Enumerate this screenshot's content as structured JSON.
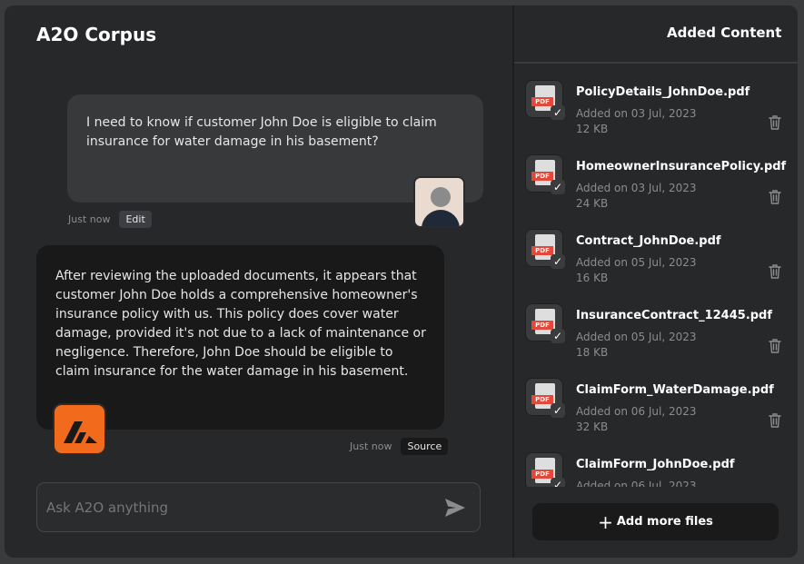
{
  "app": {
    "title": "A2O Corpus"
  },
  "messages": {
    "user": {
      "text": "I need to know if customer John Doe is eligible to claim insurance for water damage in his basement?",
      "time": "Just now",
      "action": "Edit"
    },
    "assistant": {
      "text": "After reviewing the uploaded documents, it appears that customer John Doe holds a comprehensive homeowner's insurance policy with us. This policy does cover water damage, provided it's not due to a lack of maintenance or negligence. Therefore, John Doe should be eligible to claim insurance for the water damage in his basement.",
      "time": "Just now",
      "action": "Source"
    }
  },
  "input": {
    "placeholder": "Ask A2O anything",
    "value": ""
  },
  "panel": {
    "title": "Added Content",
    "files": [
      {
        "name": "PolicyDetails_JohnDoe.pdf",
        "date": "Added on 03 Jul, 2023",
        "size": "12 KB"
      },
      {
        "name": "HomeownerInsurancePolicy.pdf",
        "date": "Added on 03 Jul, 2023",
        "size": "24 KB"
      },
      {
        "name": "Contract_JohnDoe.pdf",
        "date": "Added on 05 Jul, 2023",
        "size": "16 KB"
      },
      {
        "name": "InsuranceContract_12445.pdf",
        "date": "Added on 05 Jul, 2023",
        "size": "18 KB"
      },
      {
        "name": "ClaimForm_WaterDamage.pdf",
        "date": "Added on 06 Jul, 2023",
        "size": "32 KB"
      },
      {
        "name": "ClaimForm_JohnDoe.pdf",
        "date": "Added on 06 Jul, 2023",
        "size": ""
      }
    ],
    "file_badge": "PDF",
    "add_button": "Add more files"
  },
  "colors": {
    "accent": "#f26b1d",
    "pdf": "#e3493b",
    "bubble_user": "#38393b",
    "bubble_bot": "#19191a"
  },
  "icons": {
    "send": "send-icon",
    "trash": "trash-icon",
    "check": "check-icon",
    "plus": "plus-icon"
  }
}
